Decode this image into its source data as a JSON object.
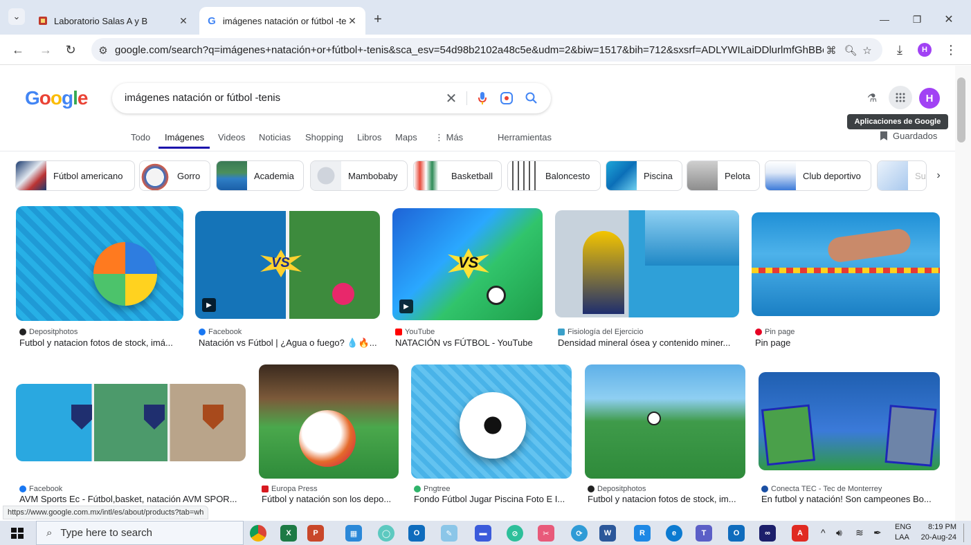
{
  "browser": {
    "tabs": [
      {
        "title": "Laboratorio Salas A y B",
        "close": "✕"
      },
      {
        "title": "imágenes natación or fútbol -te",
        "close": "✕"
      }
    ],
    "new_tab": "+",
    "tab_list": "⌄",
    "window_controls": {
      "minimize": "—",
      "restore": "❐",
      "close": "✕"
    },
    "url": "google.com/search?q=imágenes+natación+or+fútbol+-tenis&sca_esv=54d98b2102a48c5e&udm=2&biw=1517&bih=712&sxsrf=ADLYWILaiDDlurlmfGhBBo...",
    "profile_initial": "H"
  },
  "google": {
    "logo": {
      "letters": [
        "G",
        "o",
        "o",
        "g",
        "l",
        "e"
      ],
      "colors": [
        "#4285f4",
        "#ea4335",
        "#fbbc05",
        "#4285f4",
        "#34a853",
        "#ea4335"
      ]
    },
    "query": "imágenes natación or fútbol -tenis",
    "profile_initial": "H",
    "tooltip": "Aplicaciones de Google",
    "saved": "Guardados",
    "tools": "Herramientas",
    "tabs": [
      "Todo",
      "Imágenes",
      "Videos",
      "Noticias",
      "Shopping",
      "Libros",
      "Maps",
      "⋮ Más"
    ]
  },
  "chips": [
    "Fútbol americano",
    "Gorro",
    "Academia",
    "Mambobaby",
    "Basketball",
    "Baloncesto",
    "Piscina",
    "Pelota",
    "Club deportivo",
    "Su"
  ],
  "results_row1": [
    {
      "source": "Depositphotos",
      "caption": "Futbol y natacion fotos de stock, imá..."
    },
    {
      "source": "Facebook",
      "caption": "Natación vs Fútbol | ¿Agua o fuego? 💧🔥..."
    },
    {
      "source": "YouTube",
      "caption": "NATACIÓN vs FÚTBOL - YouTube"
    },
    {
      "source": "Fisiología del Ejercicio",
      "caption": "Densidad mineral ósea y contenido miner..."
    },
    {
      "source": "Pin page",
      "caption": "Pin page"
    }
  ],
  "results_row2": [
    {
      "source": "Facebook",
      "caption": "AVM Sports Ec - Fútbol,basket, natación AVM SPOR..."
    },
    {
      "source": "Europa Press",
      "caption": "Fútbol y natación son los depo..."
    },
    {
      "source": "Pngtree",
      "caption": "Fondo Fútbol Jugar Piscina Foto E I..."
    },
    {
      "source": "Depositphotos",
      "caption": "Futbol y natacion fotos de stock, im..."
    },
    {
      "source": "Conecta TEC - Tec de Monterrey",
      "caption": "En futbol y natación! Son campeones Bo..."
    }
  ],
  "status_url": "https://www.google.com.mx/intl/es/about/products?tab=wh",
  "vs_text": "VS",
  "taskbar": {
    "search_placeholder": "Type here to search",
    "lang": "ENG",
    "region": "LAA",
    "time": "8:19 PM",
    "date": "20-Aug-24"
  }
}
